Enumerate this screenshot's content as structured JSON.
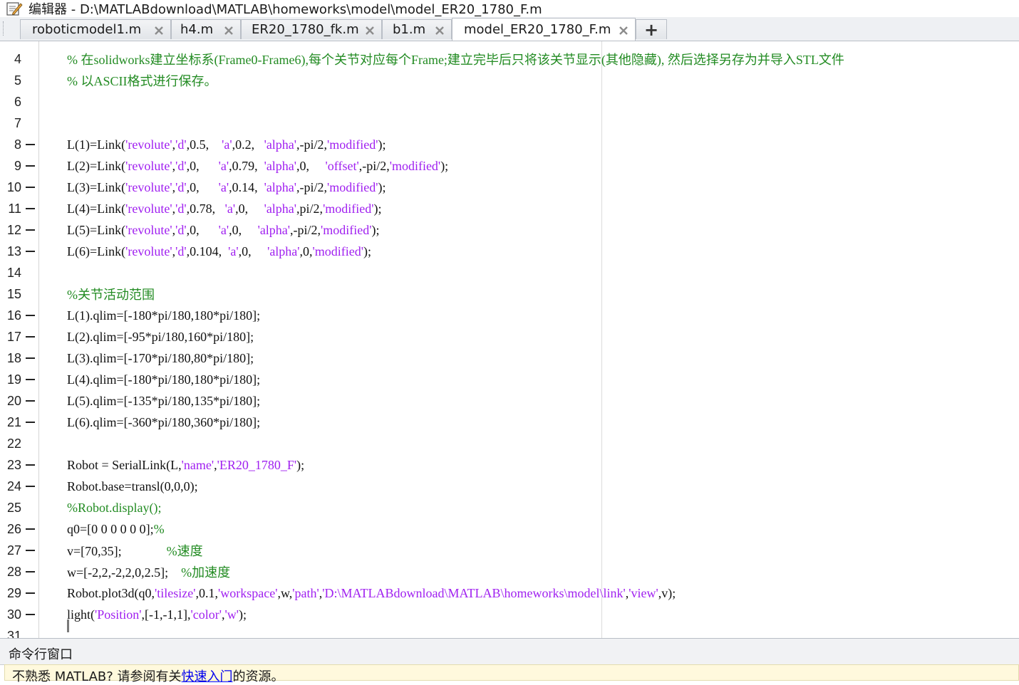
{
  "window": {
    "title": "编辑器 - D:\\MATLABdownload\\MATLAB\\homeworks\\model\\model_ER20_1780_F.m",
    "icon": "editor-pencil-icon"
  },
  "tabs": [
    {
      "label": "roboticmodel1.m",
      "active": false
    },
    {
      "label": "h4.m",
      "active": false
    },
    {
      "label": "ER20_1780_fk.m",
      "active": false
    },
    {
      "label": "b1.m",
      "active": false
    },
    {
      "label": "model_ER20_1780_F.m",
      "active": true
    }
  ],
  "add_tab_label": "+",
  "editor": {
    "lines": [
      {
        "n": "4",
        "bp": false,
        "segs": [
          {
            "t": "% 在solidworks建立坐标系(Frame0-Frame6),每个关节对应每个Frame;建立完毕后只将该关节显示(其他隐藏), 然后选择另存为并导入STL文件",
            "k": "comment"
          }
        ]
      },
      {
        "n": "5",
        "bp": false,
        "segs": [
          {
            "t": "% 以ASCII格式进行保存。",
            "k": "comment"
          }
        ]
      },
      {
        "n": "6",
        "bp": false,
        "segs": []
      },
      {
        "n": "7",
        "bp": false,
        "segs": []
      },
      {
        "n": "8",
        "bp": true,
        "segs": [
          {
            "t": "L(1)=Link(",
            "k": "code"
          },
          {
            "t": "'revolute'",
            "k": "string"
          },
          {
            "t": ",",
            "k": "code"
          },
          {
            "t": "'d'",
            "k": "string"
          },
          {
            "t": ",0.5,    ",
            "k": "code"
          },
          {
            "t": "'a'",
            "k": "string"
          },
          {
            "t": ",0.2,   ",
            "k": "code"
          },
          {
            "t": "'alpha'",
            "k": "string"
          },
          {
            "t": ",-pi/2,",
            "k": "code"
          },
          {
            "t": "'modified'",
            "k": "string"
          },
          {
            "t": ");",
            "k": "code"
          }
        ]
      },
      {
        "n": "9",
        "bp": true,
        "segs": [
          {
            "t": "L(2)=Link(",
            "k": "code"
          },
          {
            "t": "'revolute'",
            "k": "string"
          },
          {
            "t": ",",
            "k": "code"
          },
          {
            "t": "'d'",
            "k": "string"
          },
          {
            "t": ",0,      ",
            "k": "code"
          },
          {
            "t": "'a'",
            "k": "string"
          },
          {
            "t": ",0.79,  ",
            "k": "code"
          },
          {
            "t": "'alpha'",
            "k": "string"
          },
          {
            "t": ",0,     ",
            "k": "code"
          },
          {
            "t": "'offset'",
            "k": "string"
          },
          {
            "t": ",-pi/2,",
            "k": "code"
          },
          {
            "t": "'modified'",
            "k": "string"
          },
          {
            "t": ");",
            "k": "code"
          }
        ]
      },
      {
        "n": "10",
        "bp": true,
        "segs": [
          {
            "t": "L(3)=Link(",
            "k": "code"
          },
          {
            "t": "'revolute'",
            "k": "string"
          },
          {
            "t": ",",
            "k": "code"
          },
          {
            "t": "'d'",
            "k": "string"
          },
          {
            "t": ",0,      ",
            "k": "code"
          },
          {
            "t": "'a'",
            "k": "string"
          },
          {
            "t": ",0.14,  ",
            "k": "code"
          },
          {
            "t": "'alpha'",
            "k": "string"
          },
          {
            "t": ",-pi/2,",
            "k": "code"
          },
          {
            "t": "'modified'",
            "k": "string"
          },
          {
            "t": ");",
            "k": "code"
          }
        ]
      },
      {
        "n": "11",
        "bp": true,
        "segs": [
          {
            "t": "L(4)=Link(",
            "k": "code"
          },
          {
            "t": "'revolute'",
            "k": "string"
          },
          {
            "t": ",",
            "k": "code"
          },
          {
            "t": "'d'",
            "k": "string"
          },
          {
            "t": ",0.78,   ",
            "k": "code"
          },
          {
            "t": "'a'",
            "k": "string"
          },
          {
            "t": ",0,     ",
            "k": "code"
          },
          {
            "t": "'alpha'",
            "k": "string"
          },
          {
            "t": ",pi/2,",
            "k": "code"
          },
          {
            "t": "'modified'",
            "k": "string"
          },
          {
            "t": ");",
            "k": "code"
          }
        ]
      },
      {
        "n": "12",
        "bp": true,
        "segs": [
          {
            "t": "L(5)=Link(",
            "k": "code"
          },
          {
            "t": "'revolute'",
            "k": "string"
          },
          {
            "t": ",",
            "k": "code"
          },
          {
            "t": "'d'",
            "k": "string"
          },
          {
            "t": ",0,      ",
            "k": "code"
          },
          {
            "t": "'a'",
            "k": "string"
          },
          {
            "t": ",0,     ",
            "k": "code"
          },
          {
            "t": "'alpha'",
            "k": "string"
          },
          {
            "t": ",-pi/2,",
            "k": "code"
          },
          {
            "t": "'modified'",
            "k": "string"
          },
          {
            "t": ");",
            "k": "code"
          }
        ]
      },
      {
        "n": "13",
        "bp": true,
        "segs": [
          {
            "t": "L(6)=Link(",
            "k": "code"
          },
          {
            "t": "'revolute'",
            "k": "string"
          },
          {
            "t": ",",
            "k": "code"
          },
          {
            "t": "'d'",
            "k": "string"
          },
          {
            "t": ",0.104,  ",
            "k": "code"
          },
          {
            "t": "'a'",
            "k": "string"
          },
          {
            "t": ",0,     ",
            "k": "code"
          },
          {
            "t": "'alpha'",
            "k": "string"
          },
          {
            "t": ",0,",
            "k": "code"
          },
          {
            "t": "'modified'",
            "k": "string"
          },
          {
            "t": ");",
            "k": "code"
          }
        ]
      },
      {
        "n": "14",
        "bp": false,
        "segs": []
      },
      {
        "n": "15",
        "bp": false,
        "segs": [
          {
            "t": "%关节活动范围",
            "k": "comment"
          }
        ]
      },
      {
        "n": "16",
        "bp": true,
        "segs": [
          {
            "t": "L(1).qlim=[-180*pi/180,180*pi/180];",
            "k": "code"
          }
        ]
      },
      {
        "n": "17",
        "bp": true,
        "segs": [
          {
            "t": "L(2).qlim=[-95*pi/180,160*pi/180];",
            "k": "code"
          }
        ]
      },
      {
        "n": "18",
        "bp": true,
        "segs": [
          {
            "t": "L(3).qlim=[-170*pi/180,80*pi/180];",
            "k": "code"
          }
        ]
      },
      {
        "n": "19",
        "bp": true,
        "segs": [
          {
            "t": "L(4).qlim=[-180*pi/180,180*pi/180];",
            "k": "code"
          }
        ]
      },
      {
        "n": "20",
        "bp": true,
        "segs": [
          {
            "t": "L(5).qlim=[-135*pi/180,135*pi/180];",
            "k": "code"
          }
        ]
      },
      {
        "n": "21",
        "bp": true,
        "segs": [
          {
            "t": "L(6).qlim=[-360*pi/180,360*pi/180];",
            "k": "code"
          }
        ]
      },
      {
        "n": "22",
        "bp": false,
        "segs": []
      },
      {
        "n": "23",
        "bp": true,
        "segs": [
          {
            "t": "Robot = SerialLink(L,",
            "k": "code"
          },
          {
            "t": "'name'",
            "k": "string"
          },
          {
            "t": ",",
            "k": "code"
          },
          {
            "t": "'ER20_1780_F'",
            "k": "string"
          },
          {
            "t": ");",
            "k": "code"
          }
        ]
      },
      {
        "n": "24",
        "bp": true,
        "segs": [
          {
            "t": "Robot.base=transl(0,0,0);",
            "k": "code"
          }
        ]
      },
      {
        "n": "25",
        "bp": false,
        "segs": [
          {
            "t": "%Robot.display();",
            "k": "comment"
          }
        ]
      },
      {
        "n": "26",
        "bp": true,
        "segs": [
          {
            "t": "q0=[0 0 0 0 0 0];",
            "k": "code"
          },
          {
            "t": "%",
            "k": "comment"
          }
        ]
      },
      {
        "n": "27",
        "bp": true,
        "segs": [
          {
            "t": "v=[70,35];              ",
            "k": "code"
          },
          {
            "t": "%速度",
            "k": "comment"
          }
        ]
      },
      {
        "n": "28",
        "bp": true,
        "segs": [
          {
            "t": "w=[-2,2,-2,2,0,2.5];    ",
            "k": "code"
          },
          {
            "t": "%加速度",
            "k": "comment"
          }
        ]
      },
      {
        "n": "29",
        "bp": true,
        "segs": [
          {
            "t": "Robot.plot3d(q0,",
            "k": "code"
          },
          {
            "t": "'tilesize'",
            "k": "string"
          },
          {
            "t": ",0.1,",
            "k": "code"
          },
          {
            "t": "'workspace'",
            "k": "string"
          },
          {
            "t": ",w,",
            "k": "code"
          },
          {
            "t": "'path'",
            "k": "string"
          },
          {
            "t": ",",
            "k": "code"
          },
          {
            "t": "'D:\\MATLABdownload\\MATLAB\\homeworks\\model\\link'",
            "k": "string"
          },
          {
            "t": ",",
            "k": "code"
          },
          {
            "t": "'view'",
            "k": "string"
          },
          {
            "t": ",v);",
            "k": "code"
          }
        ]
      },
      {
        "n": "30",
        "bp": true,
        "segs": [
          {
            "t": "light(",
            "k": "code"
          },
          {
            "t": "'Position'",
            "k": "string"
          },
          {
            "t": ",[-1,-1,1],",
            "k": "code"
          },
          {
            "t": "'color'",
            "k": "string"
          },
          {
            "t": ",",
            "k": "code"
          },
          {
            "t": "'w'",
            "k": "string"
          },
          {
            "t": ");",
            "k": "code"
          }
        ]
      },
      {
        "n": "31",
        "bp": false,
        "segs": []
      }
    ]
  },
  "colors": {
    "comment": "#228b22",
    "string": "#a020f0",
    "code": "#111111"
  },
  "command_window": {
    "title": "命令行窗口",
    "banner_prefix": "不熟悉 MATLAB? 请参阅有关",
    "banner_link": "快速入门",
    "banner_suffix": "的资源。"
  }
}
